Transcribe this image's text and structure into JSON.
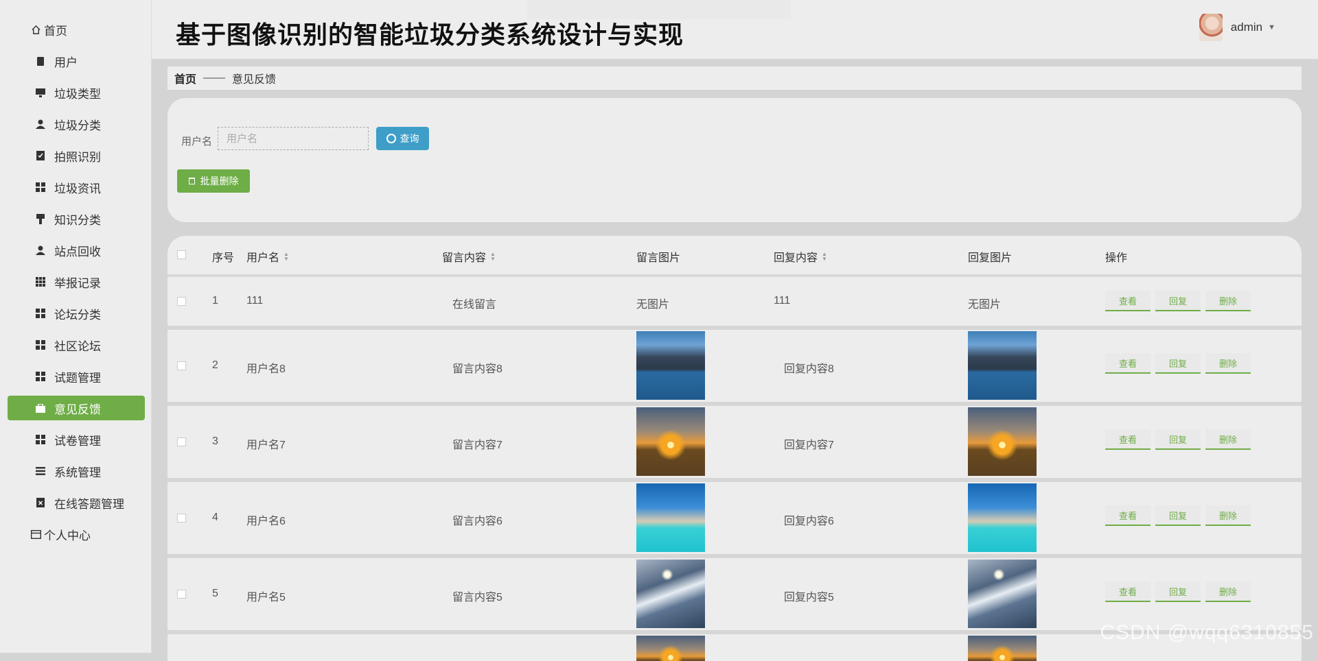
{
  "app": {
    "title": "基于图像识别的智能垃圾分类系统设计与实现",
    "user": "admin"
  },
  "sidebar": {
    "items": [
      {
        "label": "首页",
        "icon": "home-icon"
      },
      {
        "label": "用户",
        "icon": "clipboard-icon"
      },
      {
        "label": "垃圾类型",
        "icon": "monitor-icon"
      },
      {
        "label": "垃圾分类",
        "icon": "person-icon"
      },
      {
        "label": "拍照识别",
        "icon": "clipboard-check-icon"
      },
      {
        "label": "垃圾资讯",
        "icon": "grid-icon"
      },
      {
        "label": "知识分类",
        "icon": "brush-icon"
      },
      {
        "label": "站点回收",
        "icon": "person-icon"
      },
      {
        "label": "举报记录",
        "icon": "grid-dense-icon"
      },
      {
        "label": "论坛分类",
        "icon": "grid-icon"
      },
      {
        "label": "社区论坛",
        "icon": "grid-icon"
      },
      {
        "label": "试题管理",
        "icon": "grid-icon"
      },
      {
        "label": "意见反馈",
        "icon": "briefcase-icon",
        "active": true
      },
      {
        "label": "试卷管理",
        "icon": "grid-icon"
      },
      {
        "label": "系统管理",
        "icon": "list-icon"
      },
      {
        "label": "在线答题管理",
        "icon": "clipboard-x-icon"
      },
      {
        "label": "个人中心",
        "icon": "card-icon"
      }
    ]
  },
  "breadcrumb": {
    "home": "首页",
    "separator": "——",
    "current": "意见反馈"
  },
  "search": {
    "label": "用户名",
    "placeholder": "用户名",
    "button": "查询",
    "batch_delete": "批量删除"
  },
  "table": {
    "headers": {
      "index": "序号",
      "username": "用户名",
      "content": "留言内容",
      "image": "留言图片",
      "reply": "回复内容",
      "reply_image": "回复图片",
      "actions": "操作"
    },
    "action_labels": {
      "view": "查看",
      "reply": "回复",
      "delete": "删除"
    },
    "rows": [
      {
        "index": "1",
        "username": "111",
        "content": "在线留言",
        "image": "无图片",
        "reply": "111",
        "reply_image": "无图片"
      },
      {
        "index": "2",
        "username": "用户名8",
        "content": "留言内容8",
        "image": "lake-image",
        "reply": "回复内容8",
        "reply_image": "lake-image"
      },
      {
        "index": "3",
        "username": "用户名7",
        "content": "留言内容7",
        "image": "sunset-image",
        "reply": "回复内容7",
        "reply_image": "sunset-image"
      },
      {
        "index": "4",
        "username": "用户名6",
        "content": "留言内容6",
        "image": "beach-image",
        "reply": "回复内容6",
        "reply_image": "beach-image"
      },
      {
        "index": "5",
        "username": "用户名5",
        "content": "留言内容5",
        "image": "mountain-image",
        "reply": "回复内容5",
        "reply_image": "mountain-image"
      }
    ]
  },
  "watermark": "CSDN @wqq6310855",
  "colors": {
    "accent": "#6fad47",
    "search_button": "#3e9ec8"
  }
}
